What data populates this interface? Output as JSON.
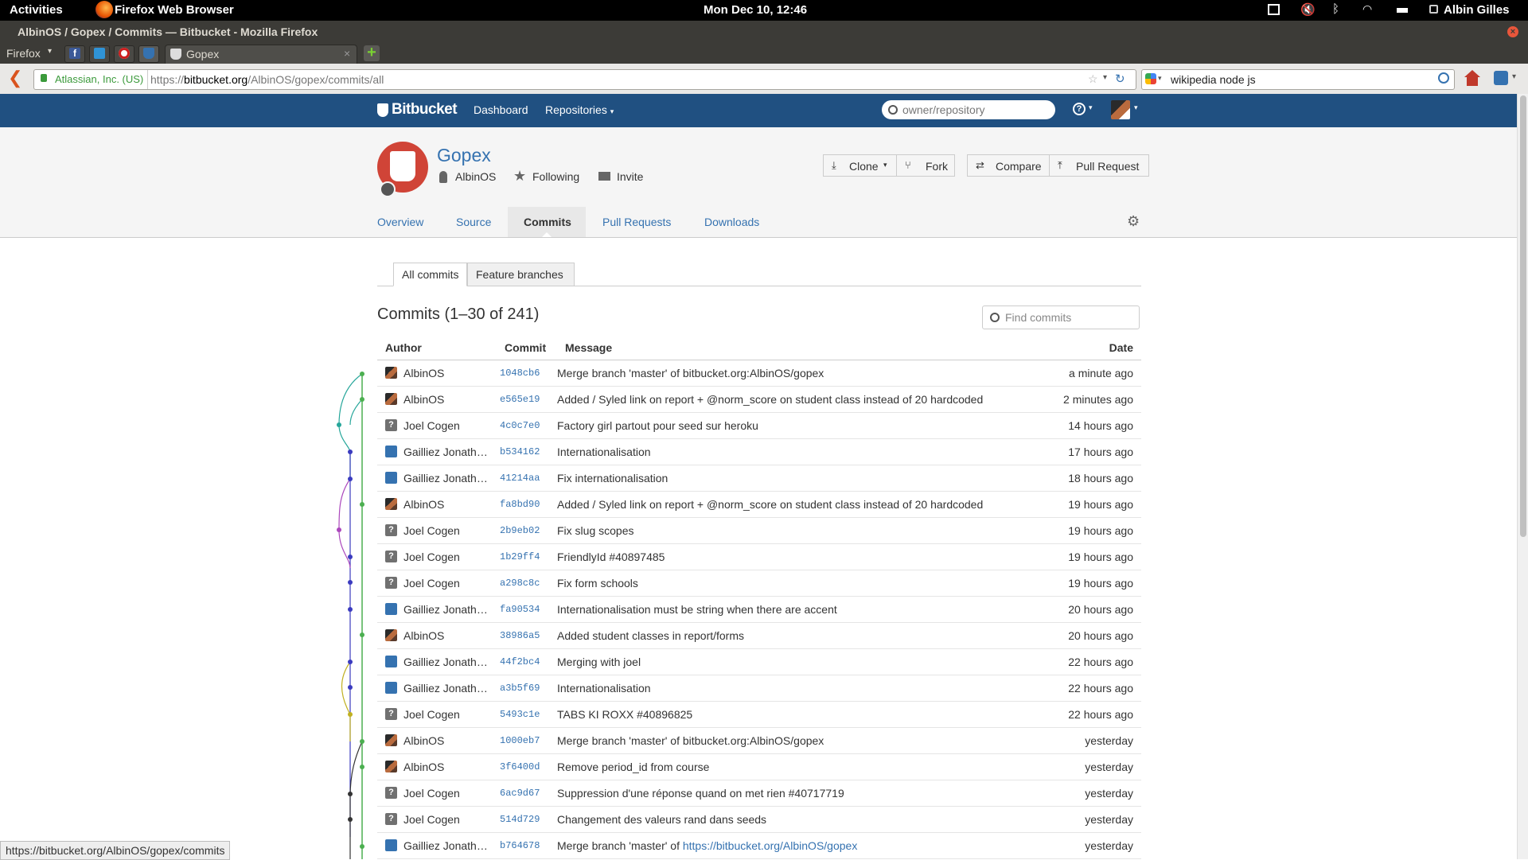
{
  "desktop": {
    "activities": "Activities",
    "app_name": "Firefox Web Browser",
    "clock": "Mon Dec 10, 12:46",
    "user": "Albin Gilles"
  },
  "window": {
    "title": "AlbinOS / Gopex / Commits — Bitbucket - Mozilla Firefox"
  },
  "firefox": {
    "menu_label": "Firefox",
    "tab_title": "Gopex",
    "identity": "Atlassian, Inc. (US)",
    "url_prefix": "https://",
    "url_domain": "bitbucket.org",
    "url_path": "/AlbinOS/gopex/commits/all",
    "search_value": "wikipedia node js"
  },
  "bitbucket": {
    "logo": "Bitbucket",
    "nav": {
      "dashboard": "Dashboard",
      "repositories": "Repositories"
    },
    "search_placeholder": "owner/repository"
  },
  "repo": {
    "name": "Gopex",
    "owner": "AlbinOS",
    "following": "Following",
    "invite": "Invite",
    "buttons": {
      "clone": "Clone",
      "fork": "Fork",
      "compare": "Compare",
      "pull_request": "Pull Request"
    },
    "tabs": [
      "Overview",
      "Source",
      "Commits",
      "Pull Requests",
      "Downloads"
    ]
  },
  "commits_page": {
    "subtabs": [
      "All commits",
      "Feature branches"
    ],
    "heading": "Commits (1–30 of 241)",
    "find_placeholder": "Find commits",
    "columns": {
      "author": "Author",
      "commit": "Commit",
      "message": "Message",
      "date": "Date"
    },
    "rows": [
      {
        "author": "AlbinOS",
        "avatar": "albin",
        "hash": "1048cb6",
        "message": "Merge branch 'master' of bitbucket.org:AlbinOS/gopex",
        "date": "a minute ago"
      },
      {
        "author": "AlbinOS",
        "avatar": "albin",
        "hash": "e565e19",
        "message": "Added / Syled link on report + @norm_score on student class instead of 20 hardcoded",
        "date": "2 minutes ago"
      },
      {
        "author": "Joel Cogen",
        "avatar": "unknown",
        "hash": "4c0c7e0",
        "message": "Factory girl partout pour seed sur heroku",
        "date": "14 hours ago"
      },
      {
        "author": "Gailliez Jonath…",
        "avatar": "user",
        "hash": "b534162",
        "message": "Internationalisation",
        "date": "17 hours ago"
      },
      {
        "author": "Gailliez Jonath…",
        "avatar": "user",
        "hash": "41214aa",
        "message": "Fix internationalisation",
        "date": "18 hours ago"
      },
      {
        "author": "AlbinOS",
        "avatar": "albin",
        "hash": "fa8bd90",
        "message": "Added / Syled link on report + @norm_score on student class instead of 20 hardcoded",
        "date": "19 hours ago"
      },
      {
        "author": "Joel Cogen",
        "avatar": "unknown",
        "hash": "2b9eb02",
        "message": "Fix slug scopes",
        "date": "19 hours ago"
      },
      {
        "author": "Joel Cogen",
        "avatar": "unknown",
        "hash": "1b29ff4",
        "message": "FriendlyId #40897485",
        "date": "19 hours ago"
      },
      {
        "author": "Joel Cogen",
        "avatar": "unknown",
        "hash": "a298c8c",
        "message": "Fix form schools",
        "date": "19 hours ago"
      },
      {
        "author": "Gailliez Jonath…",
        "avatar": "user",
        "hash": "fa90534",
        "message": "Internationalisation must be string when there are accent",
        "date": "20 hours ago"
      },
      {
        "author": "AlbinOS",
        "avatar": "albin",
        "hash": "38986a5",
        "message": "Added student classes in report/forms",
        "date": "20 hours ago"
      },
      {
        "author": "Gailliez Jonath…",
        "avatar": "user",
        "hash": "44f2bc4",
        "message": "Merging with joel",
        "date": "22 hours ago"
      },
      {
        "author": "Gailliez Jonath…",
        "avatar": "user",
        "hash": "a3b5f69",
        "message": "Internationalisation",
        "date": "22 hours ago"
      },
      {
        "author": "Joel Cogen",
        "avatar": "unknown",
        "hash": "5493c1e",
        "message": "TABS KI ROXX #40896825",
        "date": "22 hours ago"
      },
      {
        "author": "AlbinOS",
        "avatar": "albin",
        "hash": "1000eb7",
        "message": "Merge branch 'master' of bitbucket.org:AlbinOS/gopex",
        "date": "yesterday"
      },
      {
        "author": "AlbinOS",
        "avatar": "albin",
        "hash": "3f6400d",
        "message": "Remove period_id from course",
        "date": "yesterday"
      },
      {
        "author": "Joel Cogen",
        "avatar": "unknown",
        "hash": "6ac9d67",
        "message": "Suppression d'une réponse quand on met rien #40717719",
        "date": "yesterday"
      },
      {
        "author": "Joel Cogen",
        "avatar": "unknown",
        "hash": "514d729",
        "message": "Changement des valeurs rand dans seeds",
        "date": "yesterday"
      },
      {
        "author": "Gailliez Jonath…",
        "avatar": "user",
        "hash": "b764678",
        "message": "Merge branch 'master' of ",
        "link": "https://bitbucket.org/AlbinOS/gopex",
        "date": "yesterday"
      }
    ]
  },
  "status_tooltip": "https://bitbucket.org/AlbinOS/gopex/commits",
  "colors": {
    "header_blue": "#205081",
    "link_blue": "#3572b0",
    "graph_green": "#4caf50",
    "graph_blue": "#3b3bbf"
  }
}
